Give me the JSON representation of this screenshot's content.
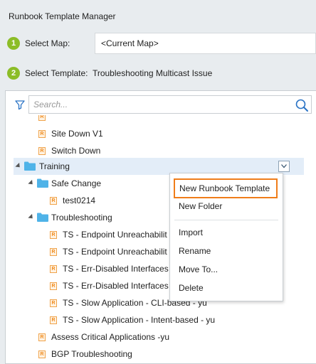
{
  "window": {
    "title": "Runbook Template Manager"
  },
  "steps": [
    {
      "num": "1",
      "label": "Select Map:"
    },
    {
      "num": "2",
      "label": "Select Template:",
      "value": "Troubleshooting Multicast Issue"
    }
  ],
  "map_field": {
    "value": "<Current Map>"
  },
  "search": {
    "placeholder": "Search..."
  },
  "tree": {
    "items": [
      {
        "label": "Site Down V1",
        "type": "runbook"
      },
      {
        "label": "Switch Down",
        "type": "runbook"
      },
      {
        "label": "Training",
        "type": "folder"
      },
      {
        "label": "Safe Change",
        "type": "folder"
      },
      {
        "label": "test0214",
        "type": "runbook"
      },
      {
        "label": "Troubleshooting",
        "type": "folder"
      },
      {
        "label": "TS - Endpoint Unreachabilit",
        "type": "runbook"
      },
      {
        "label": "TS - Endpoint Unreachabilit",
        "type": "runbook"
      },
      {
        "label": "TS - Err-Disabled Interfaces",
        "type": "runbook"
      },
      {
        "label": "TS - Err-Disabled Interfaces",
        "type": "runbook"
      },
      {
        "label": "TS - Slow Application - CLI-based - yu",
        "type": "runbook"
      },
      {
        "label": "TS - Slow Application - Intent-based - yu",
        "type": "runbook"
      },
      {
        "label": "Assess Critical Applications -yu",
        "type": "runbook"
      },
      {
        "label": "BGP Troubleshooting",
        "type": "runbook"
      }
    ]
  },
  "context_menu": {
    "items": [
      "New Runbook Template",
      "New Folder",
      "Import",
      "Rename",
      "Move To...",
      "Delete"
    ]
  },
  "colors": {
    "step_badge": "#8cbd27",
    "folder": "#4fb3e8",
    "runbook_icon": "#f08a1c",
    "selected_row": "#e3edf8",
    "highlight_border": "#f07d1a"
  }
}
